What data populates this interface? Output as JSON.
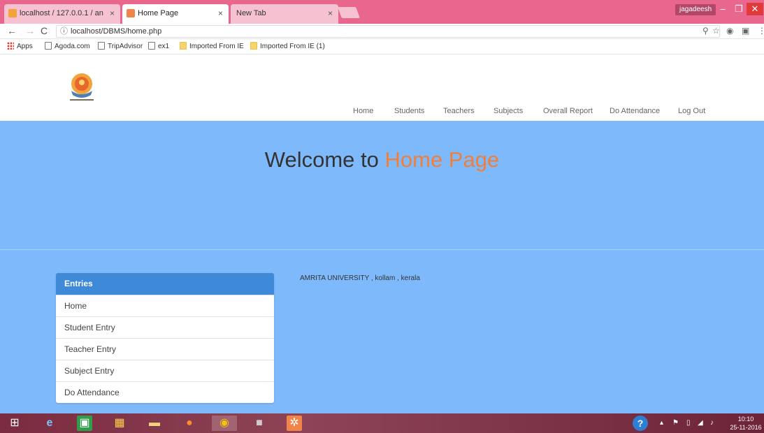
{
  "browser": {
    "tabs": [
      {
        "title": "localhost / 127.0.0.1 / an",
        "close": "×"
      },
      {
        "title": "Home Page",
        "close": "×"
      },
      {
        "title": "New Tab",
        "close": "×"
      }
    ],
    "user": "jagadeesh",
    "url": "localhost/DBMS/home.php",
    "bookmarks": {
      "apps": "Apps",
      "agoda": "Agoda.com",
      "tripadvisor": "TripAdvisor",
      "ex1": "ex1",
      "ie1": "Imported From IE",
      "ie2": "Imported From IE (1)"
    }
  },
  "nav": {
    "home": "Home",
    "students": "Students",
    "teachers": "Teachers",
    "subjects": "Subjects",
    "overall_report": "Overall Report",
    "do_attendance": "Do Attendance",
    "logout": "Log Out"
  },
  "hero": {
    "welcome": "Welcome to",
    "accent": "Home Page"
  },
  "entries": {
    "title": "Entries",
    "items": [
      "Home",
      "Student Entry",
      "Teacher Entry",
      "Subject Entry",
      "Do Attendance"
    ]
  },
  "address": "AMRITA UNIVERSITY , kollam , kerala",
  "taskbar": {
    "time": "10:10",
    "date": "25-11-2016"
  },
  "colors": {
    "hero_bg": "#7eb9fb",
    "accent": "#f07f3c",
    "panel_header": "#3e8ad8",
    "titlebar": "#e9678c"
  }
}
